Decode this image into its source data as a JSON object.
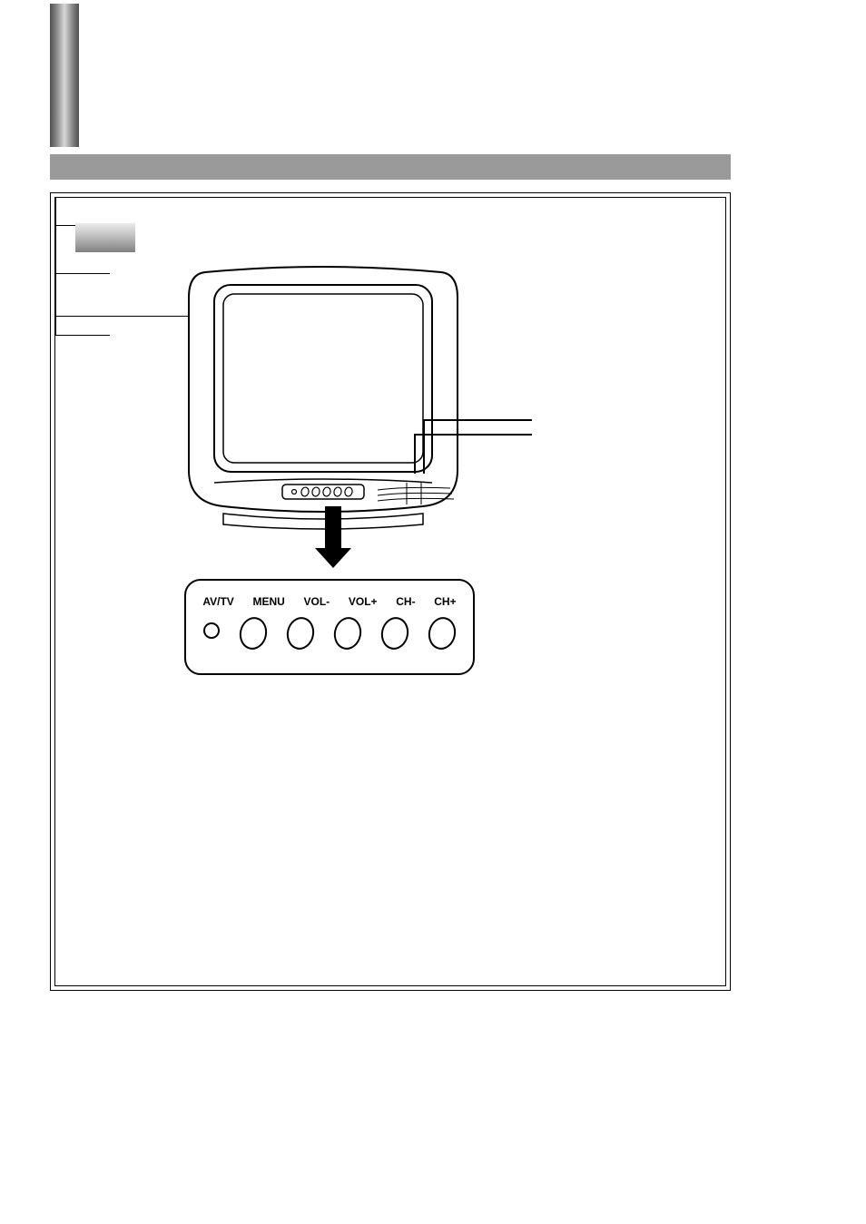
{
  "controls": {
    "labels": [
      "AV/TV",
      "MENU",
      "VOL-",
      "VOL+",
      "CH-",
      "CH+"
    ]
  }
}
